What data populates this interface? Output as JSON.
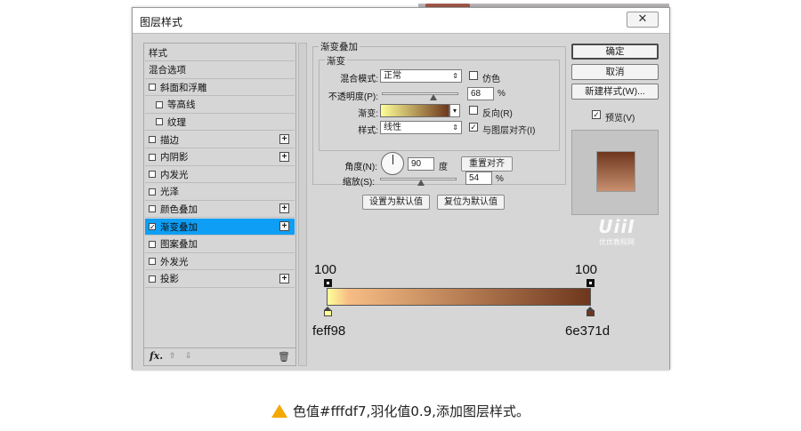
{
  "dialog": {
    "title": "图层样式",
    "close_glyph": "✕"
  },
  "styles_list": [
    {
      "label": "样式",
      "has_checkbox": false,
      "checked": false,
      "has_plus": false,
      "indent": 0
    },
    {
      "label": "混合选项",
      "has_checkbox": false,
      "checked": false,
      "has_plus": false,
      "indent": 0
    },
    {
      "label": "斜面和浮雕",
      "has_checkbox": true,
      "checked": false,
      "has_plus": false,
      "indent": 0
    },
    {
      "label": "等高线",
      "has_checkbox": true,
      "checked": false,
      "has_plus": false,
      "indent": 1
    },
    {
      "label": "纹理",
      "has_checkbox": true,
      "checked": false,
      "has_plus": false,
      "indent": 1
    },
    {
      "label": "描边",
      "has_checkbox": true,
      "checked": false,
      "has_plus": true,
      "indent": 0
    },
    {
      "label": "内阴影",
      "has_checkbox": true,
      "checked": false,
      "has_plus": true,
      "indent": 0
    },
    {
      "label": "内发光",
      "has_checkbox": true,
      "checked": false,
      "has_plus": false,
      "indent": 0
    },
    {
      "label": "光泽",
      "has_checkbox": true,
      "checked": false,
      "has_plus": false,
      "indent": 0
    },
    {
      "label": "颜色叠加",
      "has_checkbox": true,
      "checked": false,
      "has_plus": true,
      "indent": 0
    },
    {
      "label": "渐变叠加",
      "has_checkbox": true,
      "checked": true,
      "has_plus": true,
      "indent": 0,
      "selected": true
    },
    {
      "label": "图案叠加",
      "has_checkbox": true,
      "checked": false,
      "has_plus": false,
      "indent": 0
    },
    {
      "label": "外发光",
      "has_checkbox": true,
      "checked": false,
      "has_plus": false,
      "indent": 0
    },
    {
      "label": "投影",
      "has_checkbox": true,
      "checked": false,
      "has_plus": true,
      "indent": 0
    }
  ],
  "footer": {
    "fx": "fx.",
    "up": "⇧",
    "down": "⇩",
    "trash": "🗑"
  },
  "gradient_overlay": {
    "group_title": "渐变叠加",
    "sub_title": "渐变",
    "blend_mode_label": "混合模式:",
    "blend_mode_value": "正常",
    "dither_label": "仿色",
    "opacity_label": "不透明度(P):",
    "opacity_value": "68",
    "opacity_unit": "%",
    "opacity_level": 0.68,
    "gradient_label": "渐变:",
    "reverse_label": "反向(R)",
    "style_label": "样式:",
    "style_value": "线性",
    "align_label": "与图层对齐(I)",
    "align_checked_glyph": "✓",
    "angle_label": "角度(N):",
    "angle_value": "90",
    "angle_unit": "度",
    "reset_align_label": "重置对齐",
    "scale_label": "缩放(S):",
    "scale_value": "54",
    "scale_unit": "%",
    "scale_level": 0.54,
    "set_default_label": "设置为默认值",
    "reset_default_label": "复位为默认值"
  },
  "buttons": {
    "ok": "确定",
    "cancel": "取消",
    "new_style": "新建样式(W)...",
    "preview_label": "预览(V)",
    "preview_glyph": "✓"
  },
  "watermark": {
    "big": "UiiI",
    "small": "优优教程网"
  },
  "gradient_editor": {
    "left_opacity": "100",
    "right_opacity": "100",
    "left_color": "feff98",
    "right_color": "6e371d",
    "colors": {
      "left": "#feff98",
      "right": "#6e371d"
    }
  },
  "caption": {
    "text": "色值#fffdf7,羽化值0.9,添加图层样式。"
  }
}
